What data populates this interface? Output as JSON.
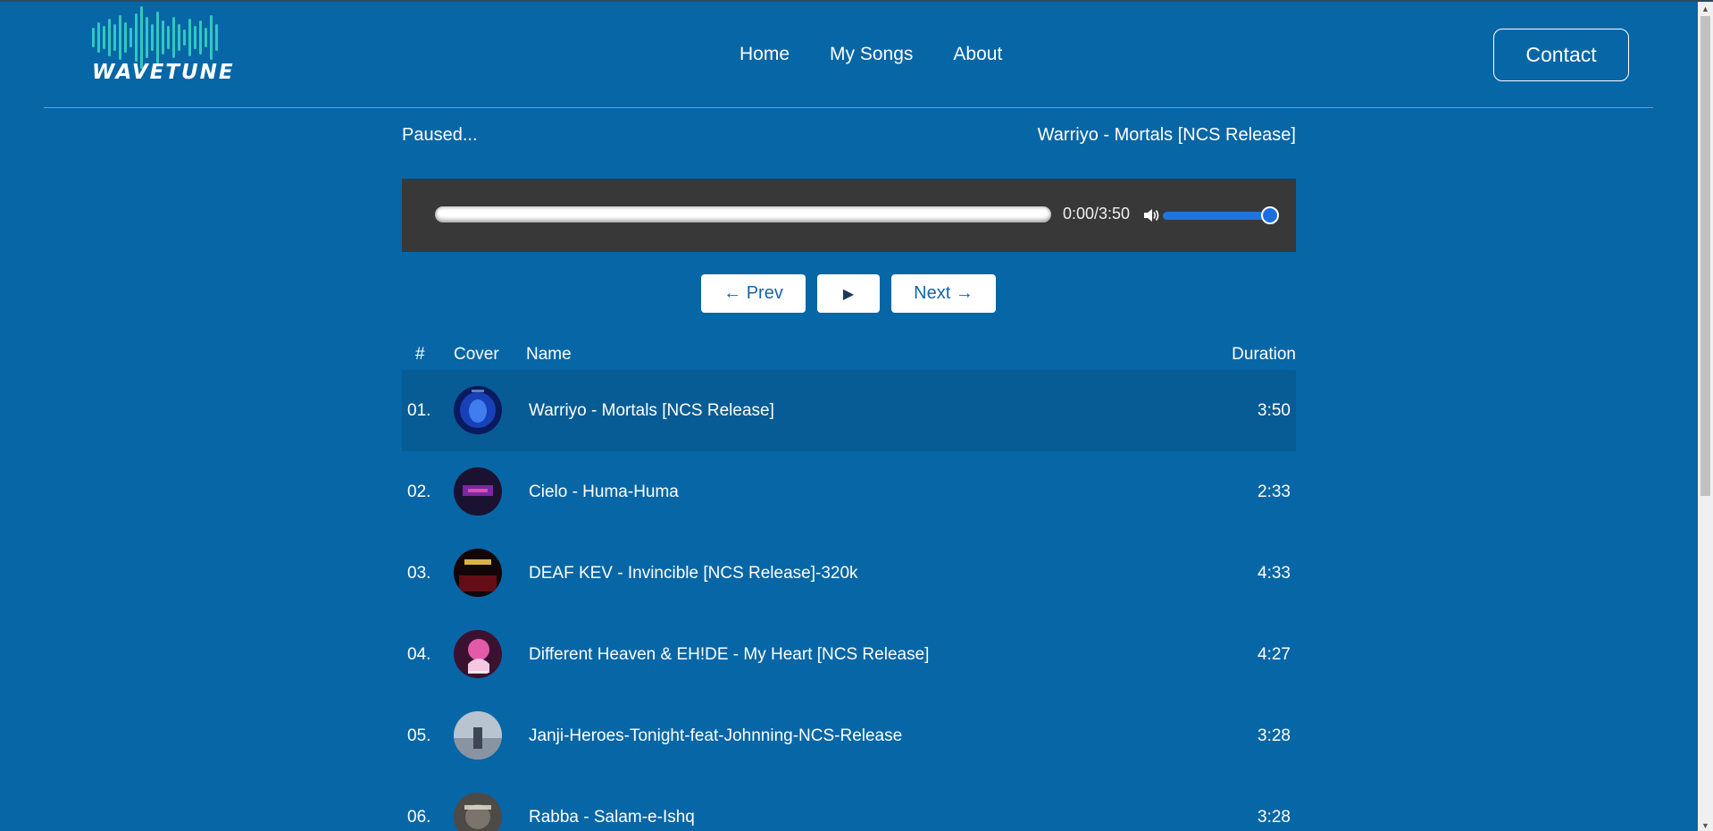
{
  "brand": {
    "name": "WAVETUNE"
  },
  "nav": {
    "items": [
      {
        "label": "Home"
      },
      {
        "label": "My Songs"
      },
      {
        "label": "About"
      }
    ]
  },
  "header": {
    "contact_label": "Contact"
  },
  "player": {
    "status": "Paused...",
    "now_playing": "Warriyo - Mortals [NCS Release]",
    "time": "0:00/3:50",
    "progress": 0,
    "volume": 1.0
  },
  "controls": {
    "prev_label": "← Prev",
    "play_label": "▶",
    "next_label": "Next →"
  },
  "table": {
    "headers": {
      "num": "#",
      "cover": "Cover",
      "name": "Name",
      "duration": "Duration"
    },
    "rows": [
      {
        "num": "01.",
        "name": "Warriyo - Mortals [NCS Release]",
        "duration": "3:50",
        "active": true
      },
      {
        "num": "02.",
        "name": "Cielo - Huma-Huma",
        "duration": "2:33"
      },
      {
        "num": "03.",
        "name": "DEAF KEV - Invincible [NCS Release]-320k",
        "duration": "4:33"
      },
      {
        "num": "04.",
        "name": "Different Heaven & EH!DE - My Heart [NCS Release]",
        "duration": "4:27"
      },
      {
        "num": "05.",
        "name": "Janji-Heroes-Tonight-feat-Johnning-NCS-Release",
        "duration": "3:28"
      },
      {
        "num": "06.",
        "name": "Rabba - Salam-e-Ishq",
        "duration": "3:28"
      }
    ]
  },
  "colors": {
    "background": "#0766a6",
    "active_row": "#075c95",
    "player_bg": "#383838",
    "accent": "#1f74e0"
  },
  "icons": {
    "volume": "speaker-icon",
    "scroll_up": "arrow-up-icon",
    "scroll_down": "arrow-down-icon"
  }
}
